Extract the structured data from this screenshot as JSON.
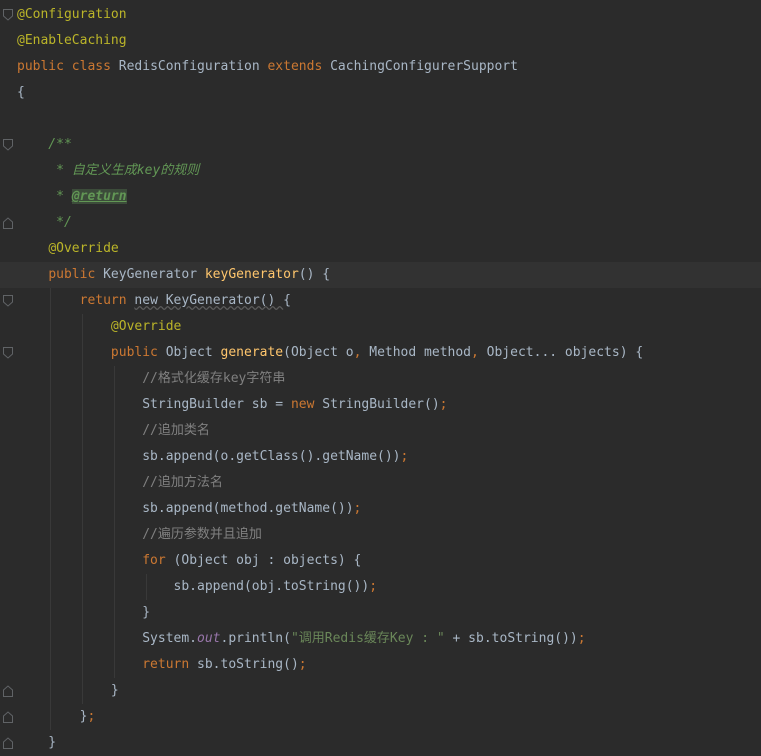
{
  "editor": {
    "language": "java",
    "lines": [
      {
        "parts": [
          {
            "t": "@Configuration",
            "c": "ann"
          }
        ]
      },
      {
        "parts": [
          {
            "t": "@EnableCaching",
            "c": "ann"
          }
        ]
      },
      {
        "parts": [
          {
            "t": "public ",
            "c": "kw"
          },
          {
            "t": "class ",
            "c": "kw"
          },
          {
            "t": "RedisConfiguration "
          },
          {
            "t": "extends ",
            "c": "kw"
          },
          {
            "t": "CachingConfigurerSupport"
          }
        ]
      },
      {
        "parts": [
          {
            "t": "{"
          }
        ]
      },
      {
        "parts": []
      },
      {
        "parts": [
          {
            "t": "    /**",
            "c": "doc"
          }
        ]
      },
      {
        "parts": [
          {
            "t": "     * 自定义生成key的规则",
            "c": "doc"
          }
        ]
      },
      {
        "parts": [
          {
            "t": "     * ",
            "c": "doc"
          },
          {
            "t": "@return",
            "c": "doctag"
          }
        ]
      },
      {
        "parts": [
          {
            "t": "     */",
            "c": "doc"
          }
        ]
      },
      {
        "parts": [
          {
            "t": "    "
          },
          {
            "t": "@Override",
            "c": "ann"
          }
        ]
      },
      {
        "parts": [
          {
            "t": "    "
          },
          {
            "t": "public ",
            "c": "kw"
          },
          {
            "t": "KeyGenerator "
          },
          {
            "t": "keyGenerator",
            "c": "fn"
          },
          {
            "t": "() {"
          }
        ],
        "current": true
      },
      {
        "parts": [
          {
            "t": "        "
          },
          {
            "t": "return ",
            "c": "kw"
          },
          {
            "t": "new KeyGenerator() ",
            "c": "squig"
          },
          {
            "t": "{"
          }
        ]
      },
      {
        "parts": [
          {
            "t": "            "
          },
          {
            "t": "@Override",
            "c": "ann"
          }
        ]
      },
      {
        "parts": [
          {
            "t": "            "
          },
          {
            "t": "public ",
            "c": "kw"
          },
          {
            "t": "Object "
          },
          {
            "t": "generate",
            "c": "fn"
          },
          {
            "t": "(Object o"
          },
          {
            "t": ", ",
            "c": "kw"
          },
          {
            "t": "Method method"
          },
          {
            "t": ", ",
            "c": "kw"
          },
          {
            "t": "Object... objects) {"
          }
        ]
      },
      {
        "parts": [
          {
            "t": "                "
          },
          {
            "t": "//格式化缓存key字符串",
            "c": "cm"
          }
        ]
      },
      {
        "parts": [
          {
            "t": "                StringBuilder sb = "
          },
          {
            "t": "new ",
            "c": "kw"
          },
          {
            "t": "StringBuilder()"
          },
          {
            "t": ";",
            "c": "kw"
          }
        ]
      },
      {
        "parts": [
          {
            "t": "                "
          },
          {
            "t": "//追加类名",
            "c": "cm"
          }
        ]
      },
      {
        "parts": [
          {
            "t": "                sb.append(o.getClass().getName())"
          },
          {
            "t": ";",
            "c": "kw"
          }
        ]
      },
      {
        "parts": [
          {
            "t": "                "
          },
          {
            "t": "//追加方法名",
            "c": "cm"
          }
        ]
      },
      {
        "parts": [
          {
            "t": "                sb.append(method.getName())"
          },
          {
            "t": ";",
            "c": "kw"
          }
        ]
      },
      {
        "parts": [
          {
            "t": "                "
          },
          {
            "t": "//遍历参数并且追加",
            "c": "cm"
          }
        ]
      },
      {
        "parts": [
          {
            "t": "                "
          },
          {
            "t": "for ",
            "c": "kw"
          },
          {
            "t": "(Object obj : objects) {"
          }
        ]
      },
      {
        "parts": [
          {
            "t": "                    sb.append(obj.toString())"
          },
          {
            "t": ";",
            "c": "kw"
          }
        ]
      },
      {
        "parts": [
          {
            "t": "                }"
          }
        ]
      },
      {
        "parts": [
          {
            "t": "                System."
          },
          {
            "t": "out",
            "c": "sfield"
          },
          {
            "t": ".println("
          },
          {
            "t": "\"调用Redis缓存Key : \"",
            "c": "str"
          },
          {
            "t": " + sb.toString())"
          },
          {
            "t": ";",
            "c": "kw"
          }
        ]
      },
      {
        "parts": [
          {
            "t": "                "
          },
          {
            "t": "return ",
            "c": "kw"
          },
          {
            "t": "sb.toString()"
          },
          {
            "t": ";",
            "c": "kw"
          }
        ]
      },
      {
        "parts": [
          {
            "t": "            }"
          }
        ]
      },
      {
        "parts": [
          {
            "t": "        }"
          },
          {
            "t": ";",
            "c": "kw"
          }
        ]
      },
      {
        "parts": [
          {
            "t": "    }"
          }
        ]
      }
    ],
    "fold_markers": [
      {
        "line": 0,
        "kind": "start"
      },
      {
        "line": 5,
        "kind": "start"
      },
      {
        "line": 8,
        "kind": "end"
      },
      {
        "line": 10,
        "kind": "start"
      },
      {
        "line": 11,
        "kind": "start"
      },
      {
        "line": 13,
        "kind": "start"
      },
      {
        "line": 26,
        "kind": "end"
      },
      {
        "line": 27,
        "kind": "end"
      },
      {
        "line": 28,
        "kind": "end"
      }
    ]
  }
}
